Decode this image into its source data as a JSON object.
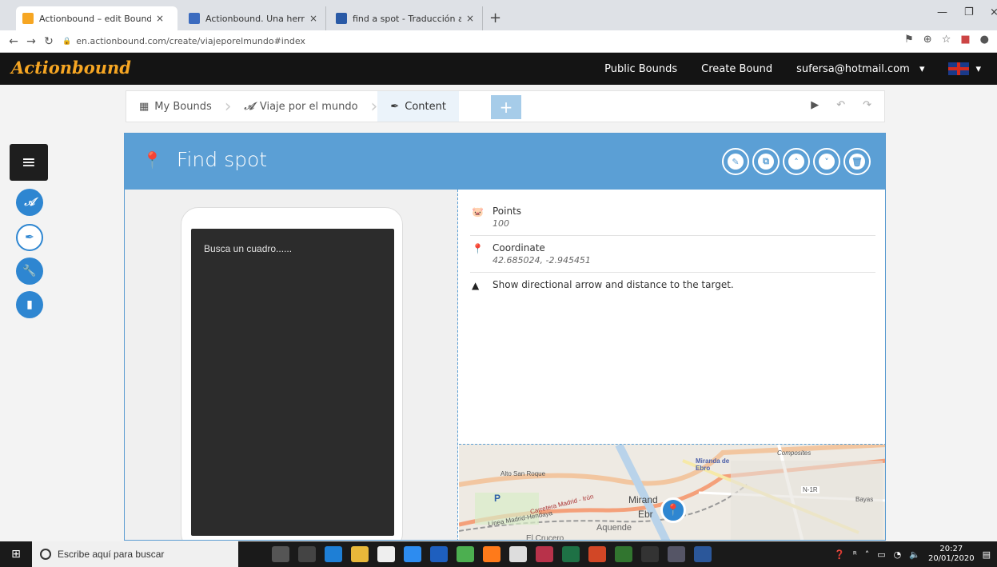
{
  "browser": {
    "tabs": [
      {
        "title": "Actionbound – edit Bound | Crea",
        "close": "×",
        "color": "#f6a623"
      },
      {
        "title": "Actionbound. Una herramienta e",
        "close": "×",
        "color": "#3b6bbf"
      },
      {
        "title": "find a spot - Traducción al españ",
        "close": "×",
        "color": "#2a5aa6"
      }
    ],
    "new_tab": "+",
    "url": "en.actionbound.com/create/viajeporelmundo#index"
  },
  "header": {
    "logo": "Actionbound",
    "nav": {
      "public_bounds": "Public Bounds",
      "create_bound": "Create Bound",
      "user_email": "sufersa@hotmail.com"
    }
  },
  "breadcrumb": {
    "items": [
      {
        "label": "My Bounds"
      },
      {
        "label": "Viaje por el mundo"
      },
      {
        "label": "Content"
      }
    ],
    "add_label": "+"
  },
  "card": {
    "title": "Find spot",
    "properties": [
      {
        "label": "Points",
        "value": "100"
      },
      {
        "label": "Coordinate",
        "value": "42.685024, -2.945451"
      },
      {
        "label": "Show directional arrow and distance to the target.",
        "value": ""
      }
    ],
    "preview_text": "Busca un cuadro......"
  },
  "map": {
    "labels": {
      "alto_san_roque": "Alto San Roque",
      "miranda_de_ebro": "Miranda de Ebro",
      "composites": "Composites",
      "n1r": "N-1R",
      "bayas": "Bayas",
      "carretera": "Carretera Madrid - Irún",
      "linea": "Línea Madrid-Hendaya",
      "mirand": "Mirand",
      "ebr": "Ebr",
      "aquende": "Aquende",
      "el_crucero": "El Crucero",
      "parking": "P"
    }
  },
  "taskbar": {
    "search_placeholder": "Escribe aquí para buscar",
    "time": "20:27",
    "date": "20/01/2020"
  },
  "colors": {
    "accent": "#5b9fd5",
    "side_blue": "#2e86d1",
    "logo": "#f6a623",
    "header_bg": "#141414"
  }
}
